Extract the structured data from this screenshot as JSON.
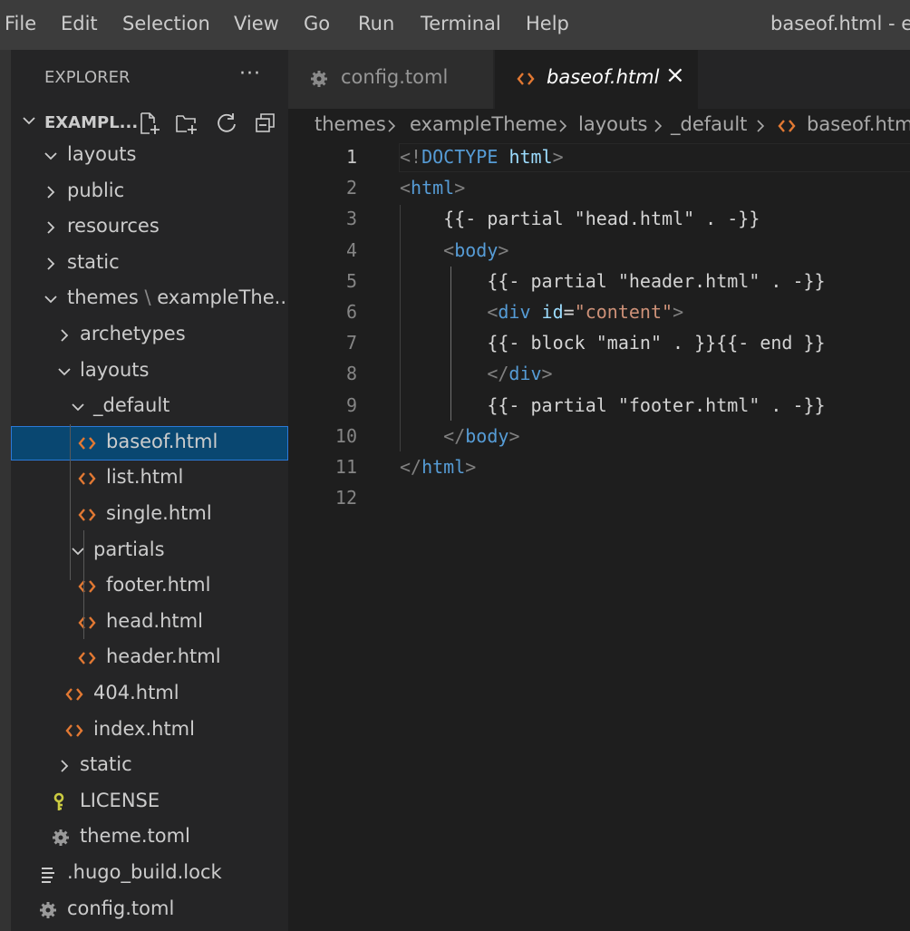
{
  "menu": [
    "File",
    "Edit",
    "Selection",
    "View",
    "Go",
    "Run",
    "Terminal",
    "Help"
  ],
  "window_title": "baseof.html - ex",
  "explorer": {
    "title": "EXPLORER",
    "more": "···",
    "section_title": "EXAMPL...",
    "tree": [
      {
        "label": "layouts",
        "kind": "folder-open",
        "depth": 0
      },
      {
        "label": "public",
        "kind": "folder-closed",
        "depth": 0
      },
      {
        "label": "resources",
        "kind": "folder-closed",
        "depth": 0
      },
      {
        "label": "static",
        "kind": "folder-closed",
        "depth": 0
      },
      {
        "label": "themes",
        "label2": "exampleThe...",
        "kind": "folder-open",
        "depth": 0
      },
      {
        "label": "archetypes",
        "kind": "folder-closed",
        "depth": 1
      },
      {
        "label": "layouts",
        "kind": "folder-open",
        "depth": 1
      },
      {
        "label": "_default",
        "kind": "folder-open",
        "depth": 2
      },
      {
        "label": "baseof.html",
        "kind": "html",
        "depth": 3,
        "selected": true
      },
      {
        "label": "list.html",
        "kind": "html",
        "depth": 3
      },
      {
        "label": "single.html",
        "kind": "html",
        "depth": 3
      },
      {
        "label": "partials",
        "kind": "folder-open",
        "depth": 2
      },
      {
        "label": "footer.html",
        "kind": "html",
        "depth": 3
      },
      {
        "label": "head.html",
        "kind": "html",
        "depth": 3
      },
      {
        "label": "header.html",
        "kind": "html",
        "depth": 3
      },
      {
        "label": "404.html",
        "kind": "html",
        "depth": 2
      },
      {
        "label": "index.html",
        "kind": "html",
        "depth": 2
      },
      {
        "label": "static",
        "kind": "folder-closed",
        "depth": 1
      },
      {
        "label": "LICENSE",
        "kind": "license",
        "depth": 1
      },
      {
        "label": "theme.toml",
        "kind": "gear",
        "depth": 1
      },
      {
        "label": ".hugo_build.lock",
        "kind": "text",
        "depth": 0
      },
      {
        "label": "config.toml",
        "kind": "gear",
        "depth": 0
      }
    ]
  },
  "tabs": [
    {
      "label": "config.toml",
      "icon": "gear-icon",
      "active": false
    },
    {
      "label": "baseof.html",
      "icon": "html-icon",
      "active": true,
      "close": "×"
    }
  ],
  "breadcrumb": [
    "themes",
    "exampleTheme",
    "layouts",
    "_default",
    "baseof.htm"
  ],
  "editor": {
    "current_line": 1,
    "lines": [
      [
        [
          "punc",
          "<!"
        ],
        [
          "tag",
          "DOCTYPE"
        ],
        [
          "text",
          " "
        ],
        [
          "attr",
          "html"
        ],
        [
          "punc",
          ">"
        ]
      ],
      [
        [
          "punc",
          "<"
        ],
        [
          "tag",
          "html"
        ],
        [
          "punc",
          ">"
        ]
      ],
      [
        [
          "text",
          "    {{- partial \"head.html\" . -}}"
        ]
      ],
      [
        [
          "text",
          "    "
        ],
        [
          "punc",
          "<"
        ],
        [
          "tag",
          "body"
        ],
        [
          "punc",
          ">"
        ]
      ],
      [
        [
          "text",
          "        {{- partial \"header.html\" . -}}"
        ]
      ],
      [
        [
          "text",
          "        "
        ],
        [
          "punc",
          "<"
        ],
        [
          "tag",
          "div"
        ],
        [
          "text",
          " "
        ],
        [
          "attr",
          "id"
        ],
        [
          "text",
          "="
        ],
        [
          "str",
          "\"content\""
        ],
        [
          "punc",
          ">"
        ]
      ],
      [
        [
          "text",
          "        {{- block \"main\" . }}{{- end }}"
        ]
      ],
      [
        [
          "text",
          "        "
        ],
        [
          "punc",
          "</"
        ],
        [
          "tag",
          "div"
        ],
        [
          "punc",
          ">"
        ]
      ],
      [
        [
          "text",
          "        {{- partial \"footer.html\" . -}}"
        ]
      ],
      [
        [
          "text",
          "    "
        ],
        [
          "punc",
          "</"
        ],
        [
          "tag",
          "body"
        ],
        [
          "punc",
          ">"
        ]
      ],
      [
        [
          "punc",
          "</"
        ],
        [
          "tag",
          "html"
        ],
        [
          "punc",
          ">"
        ]
      ],
      []
    ]
  },
  "colors": {
    "menubar": "#3c3c3c",
    "sidebar": "#252526",
    "editor": "#1e1e1e",
    "selection": "#094771",
    "html_icon": "#e37933",
    "license_icon": "#cbcb41",
    "tag": "#569cd6",
    "attr": "#9cdcfe",
    "string": "#ce9178"
  }
}
